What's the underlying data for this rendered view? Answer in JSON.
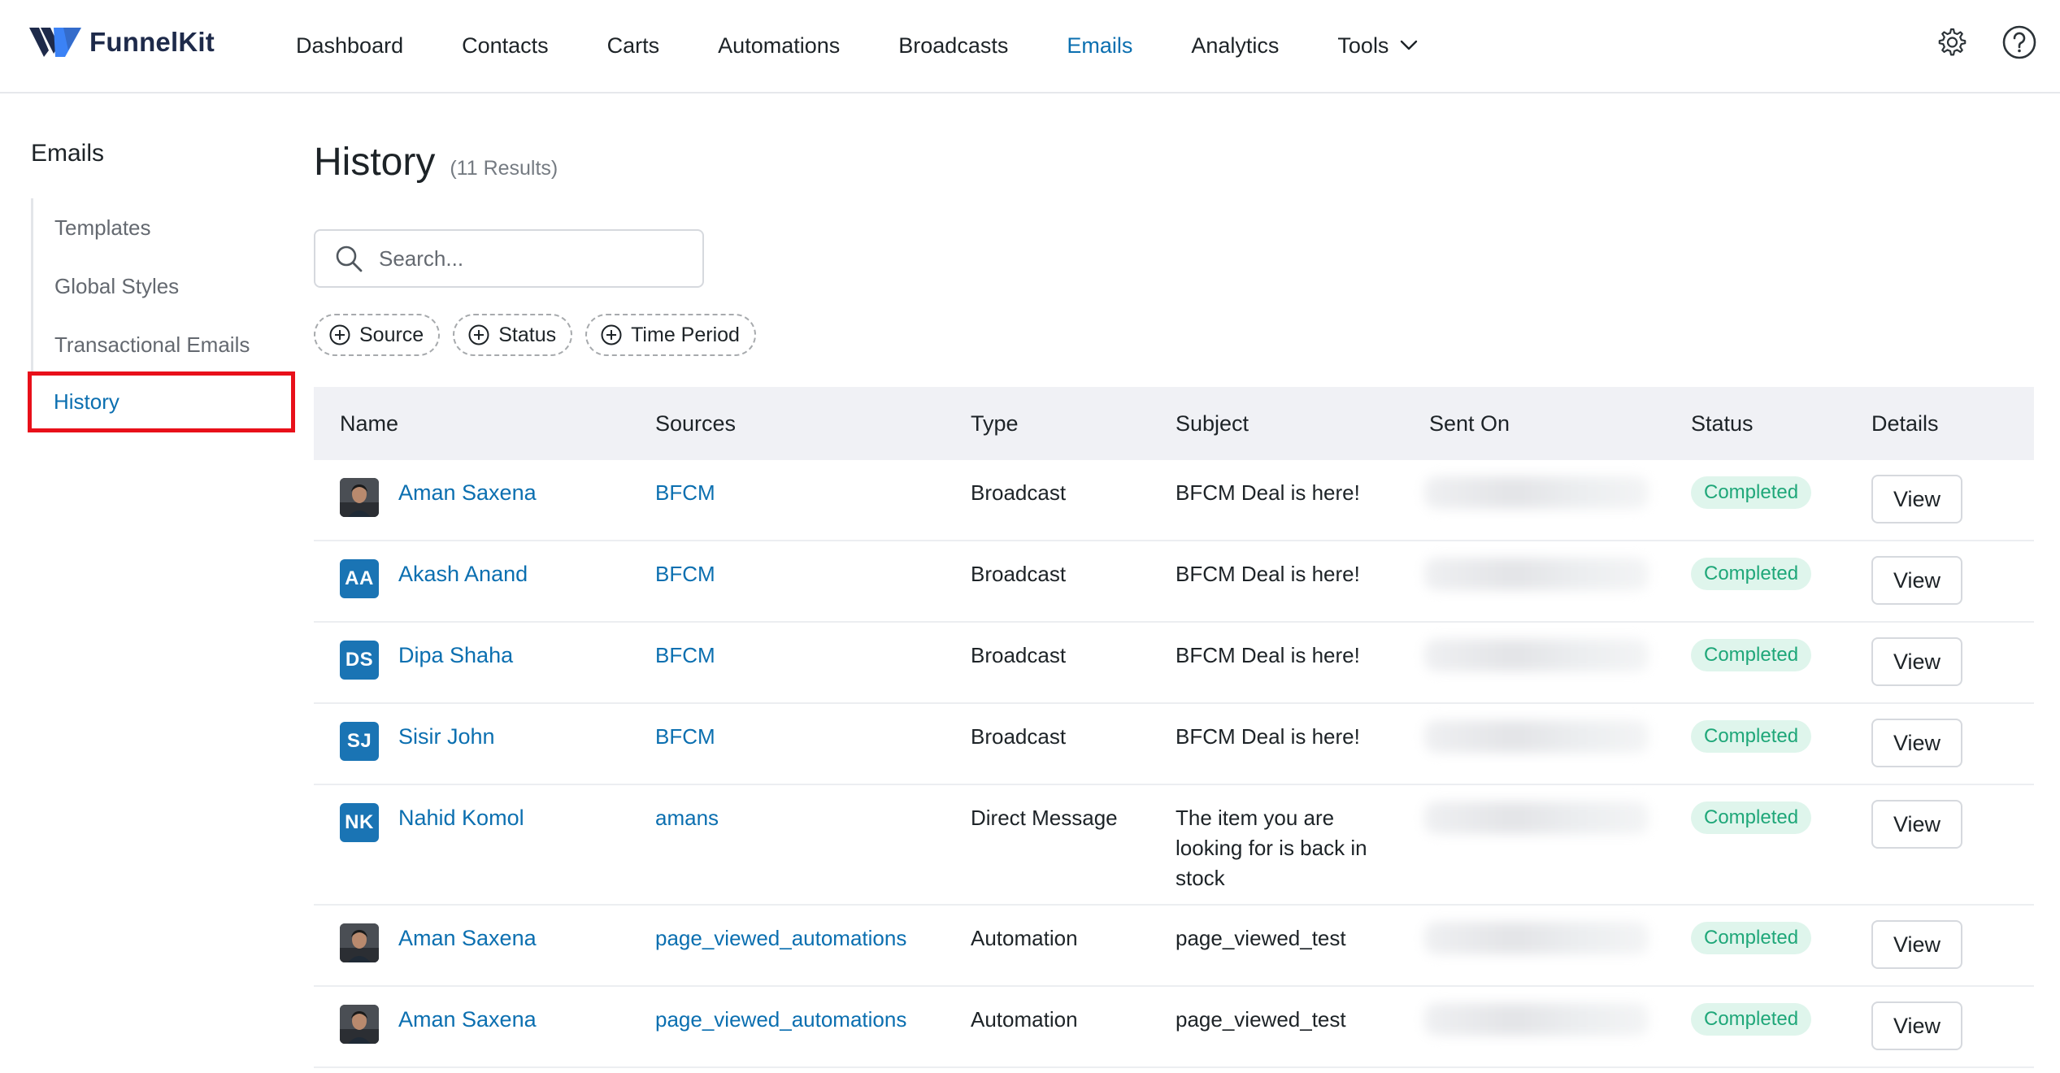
{
  "brand": {
    "name": "FunnelKit",
    "accent": "#0b6fb0",
    "mark_color": "#1e2a4a",
    "mark_accent": "#3b82f6"
  },
  "nav": {
    "items": [
      {
        "label": "Dashboard",
        "active": false
      },
      {
        "label": "Contacts",
        "active": false
      },
      {
        "label": "Carts",
        "active": false
      },
      {
        "label": "Automations",
        "active": false
      },
      {
        "label": "Broadcasts",
        "active": false
      },
      {
        "label": "Emails",
        "active": true
      },
      {
        "label": "Analytics",
        "active": false
      },
      {
        "label": "Tools",
        "active": false,
        "icon": "chevron-down-icon"
      }
    ],
    "right_icons": [
      "gear-icon",
      "help-icon"
    ]
  },
  "sidebar": {
    "title": "Emails",
    "items": [
      {
        "label": "Templates"
      },
      {
        "label": "Global Styles"
      },
      {
        "label": "Transactional Emails"
      },
      {
        "label": "History",
        "active": true
      }
    ],
    "highlight_color": "#e8101a"
  },
  "main": {
    "title": "History",
    "result_count": "(11 Results)",
    "search": {
      "placeholder": "Search...",
      "value": "",
      "icon": "search-icon"
    },
    "filters": [
      {
        "label": "Source",
        "icon": "plus-circle-icon"
      },
      {
        "label": "Status",
        "icon": "plus-circle-icon"
      },
      {
        "label": "Time Period",
        "icon": "plus-circle-icon"
      }
    ]
  },
  "table": {
    "columns": [
      "Name",
      "Sources",
      "Type",
      "Subject",
      "Sent On",
      "Status",
      "Details"
    ],
    "rows": [
      {
        "name": "Aman Saxena",
        "avatar": "photo",
        "initials": "",
        "source": "BFCM",
        "type": "Broadcast",
        "subject": "BFCM Deal is here!",
        "sent_on_blurred": true,
        "status": "Completed",
        "details": "View"
      },
      {
        "name": "Akash Anand",
        "avatar": "initials",
        "initials": "AA",
        "source": "BFCM",
        "type": "Broadcast",
        "subject": "BFCM Deal is here!",
        "sent_on_blurred": true,
        "status": "Completed",
        "details": "View"
      },
      {
        "name": "Dipa Shaha",
        "avatar": "initials",
        "initials": "DS",
        "source": "BFCM",
        "type": "Broadcast",
        "subject": "BFCM Deal is here!",
        "sent_on_blurred": true,
        "status": "Completed",
        "details": "View"
      },
      {
        "name": "Sisir John",
        "avatar": "initials",
        "initials": "SJ",
        "source": "BFCM",
        "type": "Broadcast",
        "subject": "BFCM Deal is here!",
        "sent_on_blurred": true,
        "status": "Completed",
        "details": "View"
      },
      {
        "name": "Nahid Komol",
        "avatar": "initials",
        "initials": "NK",
        "source": "amans",
        "type": "Direct Message",
        "subject": "The item you are looking for is back in stock",
        "sent_on_blurred": true,
        "status": "Completed",
        "details": "View"
      },
      {
        "name": "Aman Saxena",
        "avatar": "photo",
        "initials": "",
        "source": "page_viewed_automations",
        "type": "Automation",
        "subject": "page_viewed_test",
        "sent_on_blurred": true,
        "status": "Completed",
        "details": "View"
      },
      {
        "name": "Aman Saxena",
        "avatar": "photo",
        "initials": "",
        "source": "page_viewed_automations",
        "type": "Automation",
        "subject": "page_viewed_test",
        "sent_on_blurred": true,
        "status": "Completed",
        "details": "View"
      }
    ],
    "status_color": "#1fa779",
    "status_bg": "#dff5ec"
  }
}
